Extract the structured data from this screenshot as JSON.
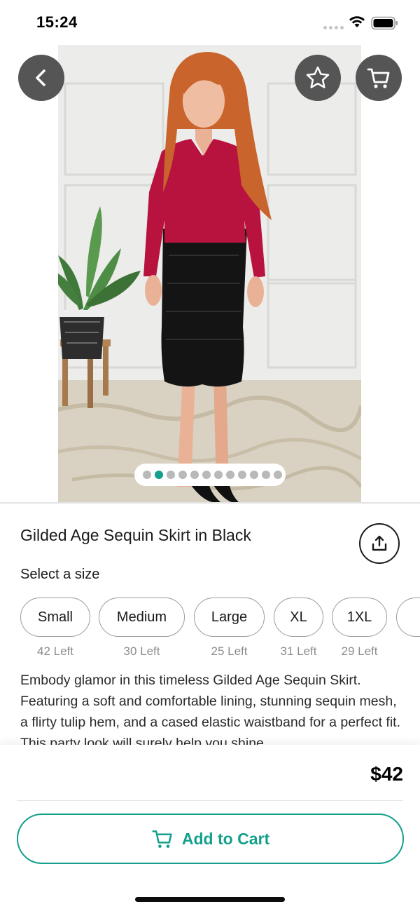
{
  "status_bar": {
    "time": "15:24"
  },
  "hero": {
    "image_subject": "model wearing red blouse and black sequin midi skirt",
    "page_count": 12,
    "active_page": 2
  },
  "top_actions": {
    "back_icon": "chevron-left-icon",
    "favorite_icon": "star-outline-icon",
    "cart_icon": "cart-icon"
  },
  "product": {
    "title": "Gilded Age Sequin Skirt in Black",
    "share_icon": "share-icon",
    "size_prompt": "Select a size",
    "sizes": [
      {
        "label": "Small",
        "stock": "42 Left"
      },
      {
        "label": "Medium",
        "stock": "30 Left"
      },
      {
        "label": "Large",
        "stock": "25 Left"
      },
      {
        "label": "XL",
        "stock": "31 Left"
      },
      {
        "label": "1XL",
        "stock": "29 Left"
      }
    ],
    "description": "Embody glamor in this timeless Gilded Age Sequin Skirt. Featuring a soft and comfortable lining, stunning sequin mesh, a flirty tulip hem, and a cased elastic waistband for a perfect fit. This party look will surely help you shine"
  },
  "checkout": {
    "price": "$42",
    "add_to_cart_label": "Add to Cart",
    "add_to_cart_icon": "cart-icon"
  },
  "colors": {
    "accent": "#14a08c",
    "overlay_button": "#555555",
    "blouse": "#b8123f",
    "skirt": "#141414"
  }
}
